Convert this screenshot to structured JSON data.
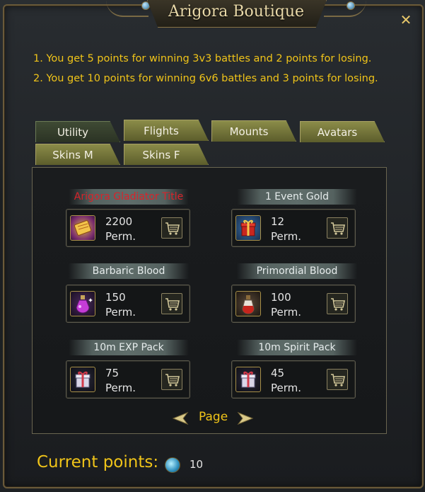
{
  "window": {
    "title": "Arigora Boutique",
    "close_icon": "close-x-icon"
  },
  "info": {
    "line1": "1. You get 5 points for winning 3v3 battles and 2 points for losing.",
    "line2": "2. You get 10 points for winning 6v6 battles and 3 points for losing."
  },
  "tabs": [
    {
      "label": "Utility",
      "active": true
    },
    {
      "label": "Flights",
      "active": false
    },
    {
      "label": "Mounts",
      "active": false
    },
    {
      "label": "Avatars",
      "active": false
    },
    {
      "label": "Skins M",
      "active": false
    },
    {
      "label": "Skins F",
      "active": false
    }
  ],
  "items": [
    {
      "title": "Arigora Gladiator Title",
      "title_color": "#d8232a",
      "cost": "2200",
      "duration": "Perm.",
      "icon": "gladiator-scroll-icon"
    },
    {
      "title": "1 Event Gold",
      "cost": "12",
      "duration": "Perm.",
      "icon": "red-gift-box-icon"
    },
    {
      "title": "Barbaric Blood",
      "cost": "150",
      "duration": "Perm.",
      "icon": "purple-potion-icon"
    },
    {
      "title": "Primordial Blood",
      "cost": "100",
      "duration": "Perm.",
      "icon": "red-potion-icon"
    },
    {
      "title": "10m EXP Pack",
      "cost": "75",
      "duration": "Perm.",
      "icon": "exp-gift-pack-icon"
    },
    {
      "title": "10m Spirit Pack",
      "cost": "45",
      "duration": "Perm.",
      "icon": "spirit-gift-pack-icon"
    }
  ],
  "pager": {
    "label": "Page"
  },
  "footer": {
    "points_label": "Current points:",
    "points_value": "10",
    "currency_icon": "blue-coin-icon"
  },
  "colors": {
    "accent_text": "#f0c419",
    "tab_color": "#8b8c49",
    "highlight_red": "#d8232a"
  }
}
